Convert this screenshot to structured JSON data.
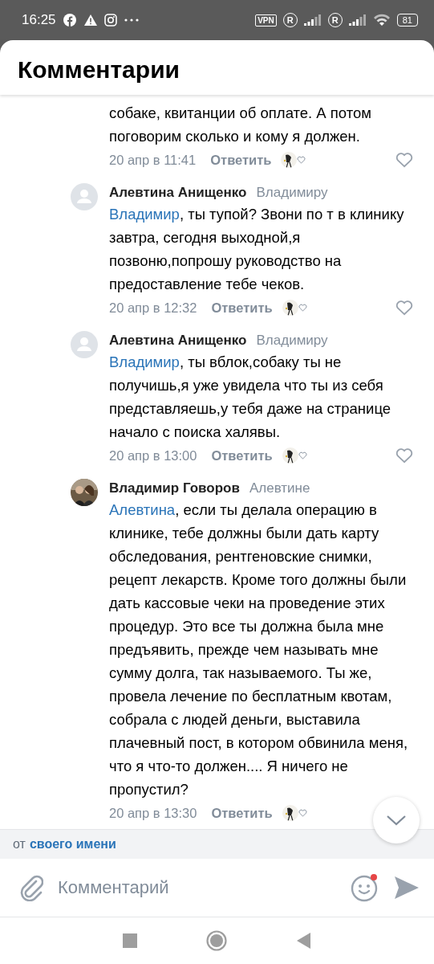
{
  "status_bar": {
    "time": "16:25",
    "vpn": "VPN",
    "roaming": [
      "R",
      "R"
    ],
    "battery": "81"
  },
  "header": {
    "title": "Комментарии"
  },
  "comments": [
    {
      "text": "собаке, квитанции об оплате. А потом поговорим сколько и кому я должен.",
      "time": "20 апр в 11:41",
      "reply_label": "Ответить",
      "liked": false
    },
    {
      "avatar": {
        "kind": "placeholder"
      },
      "author": "Алевтина Анищенко",
      "reply_to": "Владимиру",
      "mention": "Владимир",
      "text": ", ты тупой? Звони по т в клинику завтра, сегодня выходной,я позвоню,попрошу руководство на предоставление тебе чеков.",
      "time": "20 апр в 12:32",
      "reply_label": "Ответить",
      "liked": false
    },
    {
      "avatar": {
        "kind": "placeholder"
      },
      "author": "Алевтина Анищенко",
      "reply_to": "Владимиру",
      "mention": "Владимир",
      "text": ", ты вблок,собаку ты не получишь,я уже увидела что ты из себя представляешь,у тебя даже на странице начало с поиска халявы.",
      "time": "20 апр в 13:00",
      "reply_label": "Ответить",
      "liked": false
    },
    {
      "author": "Владимир Говоров",
      "reply_to": "Алевтине",
      "mention": "Алевтина",
      "text": ", если ты делала операцию в клинике, тебе должны были дать карту обследования, рентгеновские снимки, рецепт лекарств. Кроме того должны были дать кассовые чеки на проведение этих процедур. Это все ты должна была мне предъявить, прежде чем называть мне сумму долга, так называемого. Ты же, провела лечение по бесплатным квотам, собрала с людей деньги, выставила плачевный пост, в котором обвинила меня, что я что-то должен.... Я ничего не пропустил?",
      "time": "20 апр в 13:30",
      "reply_label": "Ответить"
    }
  ],
  "author_bar": {
    "prefix": "от",
    "link": "своего имени"
  },
  "input": {
    "placeholder": "Комментарий",
    "emoji_badge": true
  }
}
